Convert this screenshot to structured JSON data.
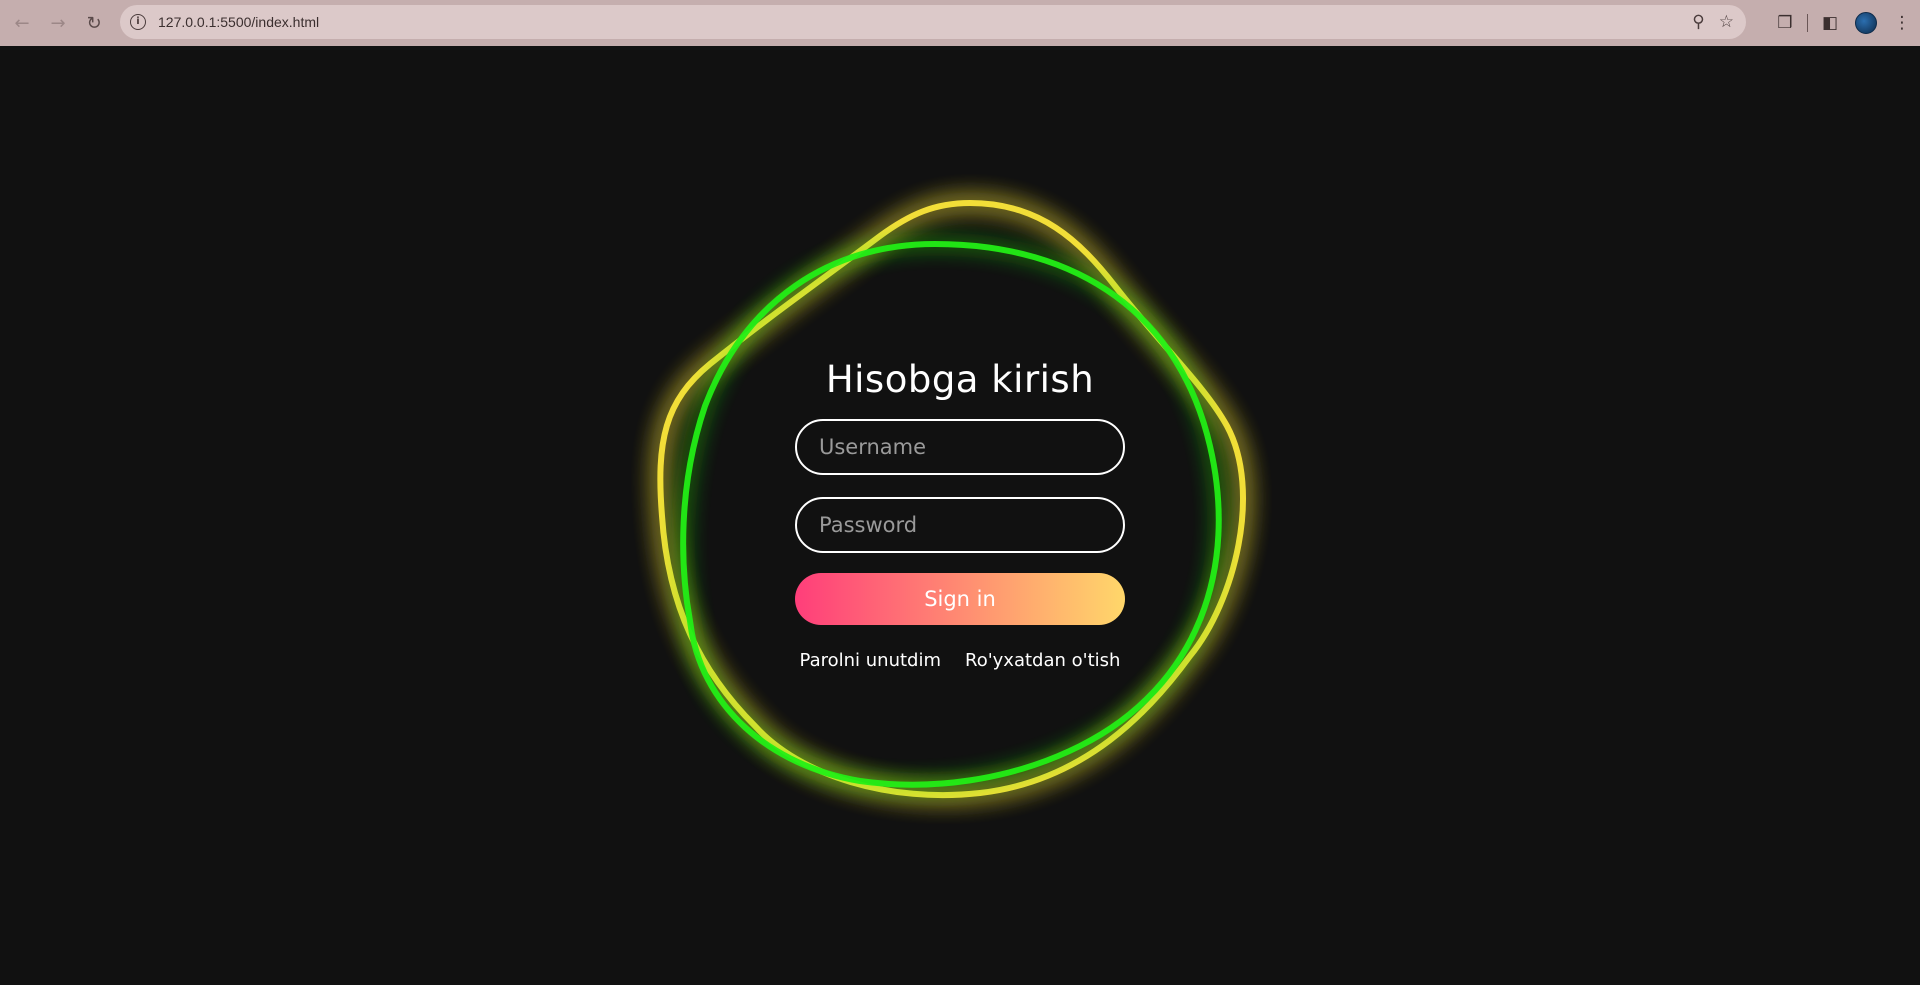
{
  "browser": {
    "url": "127.0.0.1:5500/index.html",
    "icons": {
      "back": "arrow-left-icon",
      "forward": "arrow-right-icon",
      "reload": "reload-icon",
      "site_info": "info-icon",
      "zoom": "zoom-icon",
      "bookmark": "star-icon",
      "extensions": "puzzle-icon",
      "side_panel": "side-panel-icon",
      "profile": "avatar",
      "menu": "kebab-menu-icon"
    }
  },
  "login": {
    "title": "Hisobga kirish",
    "username_placeholder": "Username",
    "password_placeholder": "Password",
    "signin_label": "Sign in",
    "forgot_label": "Parolni unutdim",
    "register_label": "Ro'yxatdan o'tish"
  },
  "colors": {
    "background": "#111111",
    "ring_yellow": "#ffea3a",
    "ring_green": "#22f012",
    "button_gradient_start": "#ff3e7a",
    "button_gradient_end": "#ffd76a"
  }
}
